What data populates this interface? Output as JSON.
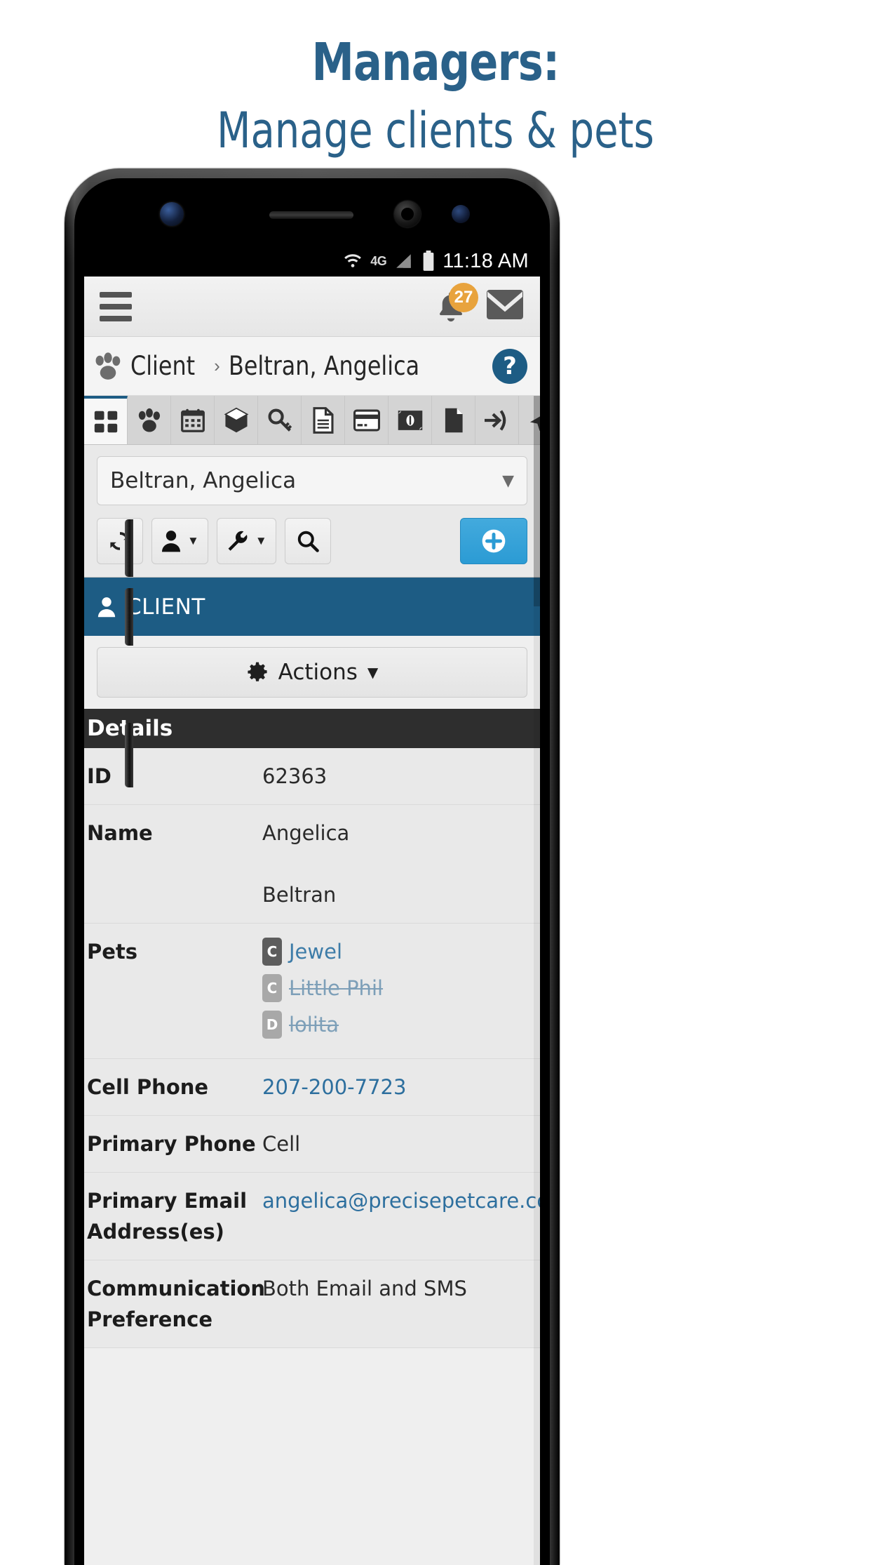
{
  "promo": {
    "title": "Managers:",
    "subtitle": "Manage clients & pets",
    "brand_color": "#2a6189"
  },
  "statusbar": {
    "wifi_icon": "wifi-icon",
    "network_label": "4G",
    "signal_icon": "signal-bars-icon",
    "battery_icon": "battery-icon",
    "time": "11:18 AM"
  },
  "appbar": {
    "menu_icon": "hamburger-menu-icon",
    "notifications_icon": "bell-icon",
    "notification_count": "27",
    "messages_icon": "envelope-icon"
  },
  "breadcrumb": {
    "paw_icon": "paw-icon",
    "root": "Client",
    "separator": "›",
    "current": "Beltran, Angelica",
    "help_icon": "help-question-icon",
    "help_label": "?"
  },
  "tabs": [
    {
      "name": "dashboard",
      "icon": "grid-icon",
      "active": true
    },
    {
      "name": "pets",
      "icon": "paw-icon",
      "active": false
    },
    {
      "name": "calendar",
      "icon": "calendar-icon",
      "active": false
    },
    {
      "name": "packages",
      "icon": "box-icon",
      "active": false
    },
    {
      "name": "keys",
      "icon": "key-icon",
      "active": false
    },
    {
      "name": "notes",
      "icon": "document-lines-icon",
      "active": false
    },
    {
      "name": "payment-methods",
      "icon": "credit-card-icon",
      "active": false
    },
    {
      "name": "billing",
      "icon": "money-icon",
      "active": false
    },
    {
      "name": "files",
      "icon": "file-icon",
      "active": false
    },
    {
      "name": "login-as",
      "icon": "sign-in-icon",
      "active": false
    },
    {
      "name": "send-message",
      "icon": "paper-plane-icon",
      "active": false
    }
  ],
  "client_select": {
    "value": "Beltran, Angelica",
    "caret_icon": "chevron-down-icon"
  },
  "toolbar": {
    "refresh_icon": "refresh-icon",
    "person_icon": "person-icon",
    "wrench_icon": "wrench-icon",
    "search_icon": "search-icon",
    "add_icon": "plus-circle-icon",
    "caret_icon": "caret-down-icon"
  },
  "section": {
    "person_icon": "person-icon",
    "title": "CLIENT"
  },
  "actions": {
    "gear_icon": "gear-icon",
    "label": "Actions",
    "caret_icon": "caret-down-icon"
  },
  "details": {
    "header": "Details",
    "rows": [
      {
        "label": "ID",
        "value": "62363",
        "type": "text"
      },
      {
        "label": "Name",
        "value": "Angelica",
        "value2": "Beltran",
        "type": "name"
      },
      {
        "label": "Pets",
        "type": "pets"
      },
      {
        "label": "Cell Phone",
        "value": "207-200-7723",
        "type": "link"
      },
      {
        "label": "Primary Phone",
        "value": "Cell",
        "type": "text"
      },
      {
        "label": "Primary Email Address(es)",
        "value": "angelica@precisepetcare.com",
        "type": "link"
      },
      {
        "label": "Communication Preference",
        "value": "Both Email and SMS",
        "type": "text"
      }
    ],
    "pets": [
      {
        "badge": "C",
        "name": "Jewel",
        "active": true
      },
      {
        "badge": "C",
        "name": "Little Phil",
        "active": false
      },
      {
        "badge": "D",
        "name": "lolita",
        "active": false
      }
    ]
  }
}
